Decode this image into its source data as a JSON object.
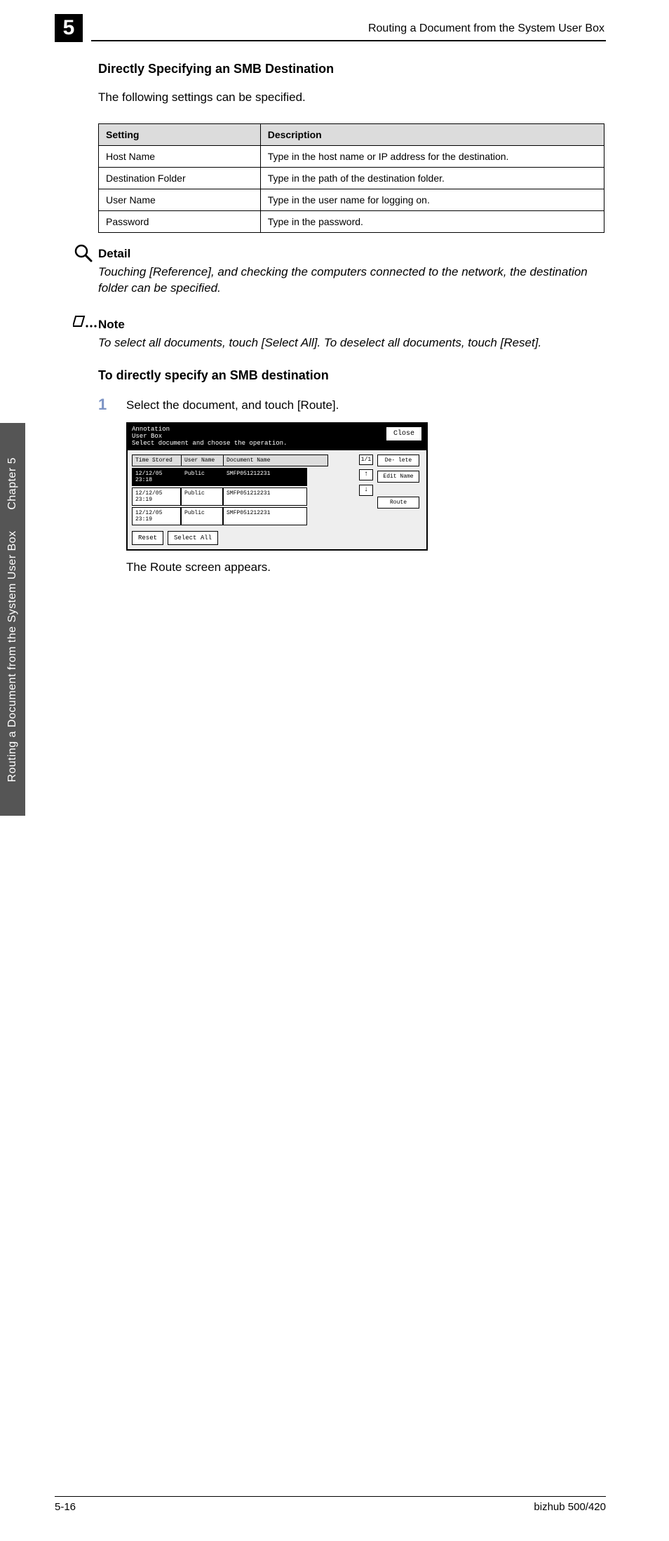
{
  "chapter": {
    "number": "5",
    "running_head": "Routing a Document from the System User Box",
    "side_tab_line1": "Routing a Document from the System User Box",
    "side_tab_line2": "Chapter 5"
  },
  "section": {
    "title": "Directly Specifying an SMB Destination",
    "intro": "The following settings can be specified."
  },
  "settings_table": {
    "headers": [
      "Setting",
      "Description"
    ],
    "rows": [
      [
        "Host Name",
        "Type in the host name or IP address for the destination."
      ],
      [
        "Destination Folder",
        "Type in the path of the destination folder."
      ],
      [
        "User Name",
        "Type in the user name for logging on."
      ],
      [
        "Password",
        "Type in the password."
      ]
    ]
  },
  "detail": {
    "label": "Detail",
    "body": "Touching [Reference], and checking the computers connected to the network, the destination folder can be specified."
  },
  "note": {
    "label": "Note",
    "body": "To select all documents, touch [Select All]. To deselect all documents, touch [Reset]."
  },
  "procedure": {
    "title": "To directly specify an SMB destination",
    "step1_num": "1",
    "step1_text": "Select the document, and touch [Route].",
    "after": "The Route screen appears."
  },
  "lcd": {
    "title_line1": "Annotation",
    "title_line2": "User Box",
    "subtitle": "Select document and choose the operation.",
    "close": "Close",
    "col_time": "Time Stored",
    "col_user": "User Name",
    "col_doc": "Document Name",
    "rows": [
      {
        "time": "12/12/05 23:18",
        "user": "Public",
        "doc": "SMFP051212231",
        "selected": true
      },
      {
        "time": "12/12/05 23:19",
        "user": "Public",
        "doc": "SMFP051212231",
        "selected": false
      },
      {
        "time": "12/12/05 23:19",
        "user": "Public",
        "doc": "SMFP051212231",
        "selected": false
      }
    ],
    "pager": "1/1",
    "arrow_up": "↑",
    "arrow_down": "↓",
    "btn_delete": "De- lete",
    "btn_edit": "Edit Name",
    "btn_route": "Route",
    "btn_reset": "Reset",
    "btn_select_all": "Select All"
  },
  "footer": {
    "page": "5-16",
    "product": "bizhub 500/420"
  }
}
